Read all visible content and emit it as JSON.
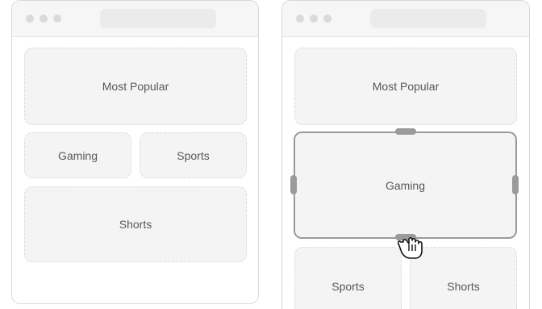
{
  "left_window": {
    "tiles": {
      "most_popular": "Most Popular",
      "gaming": "Gaming",
      "sports": "Sports",
      "shorts": "Shorts"
    }
  },
  "right_window": {
    "tiles": {
      "most_popular": "Most Popular",
      "gaming": "Gaming",
      "sports": "Sports",
      "shorts": "Shorts"
    },
    "selected_tile": "Gaming",
    "cursor": "grab-hand-icon"
  },
  "colors": {
    "tile_fill": "#f4f4f4",
    "tile_border": "#dcdcdc",
    "selection_border": "#9a9a9a",
    "handle": "#9b9b9b",
    "text": "#585858"
  }
}
